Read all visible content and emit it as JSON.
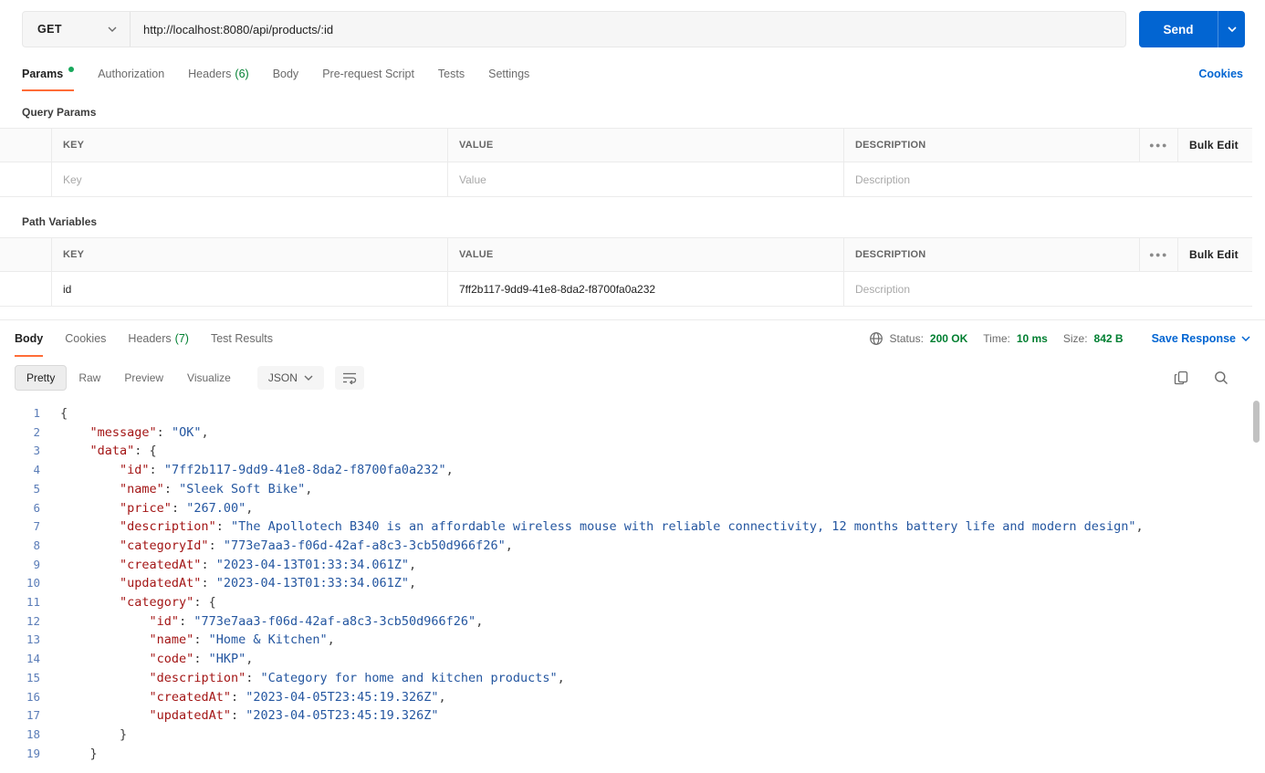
{
  "colors": {
    "accent_orange": "#ff6c37",
    "primary_blue": "#0265d2",
    "success_green": "#007f31",
    "json_key": "#a31515",
    "json_string": "#2456a0"
  },
  "request": {
    "method": "GET",
    "url": "http://localhost:8080/api/products/:id",
    "send_label": "Send",
    "cookies_link": "Cookies",
    "tabs": [
      {
        "label": "Params"
      },
      {
        "label": "Authorization"
      },
      {
        "label": "Headers",
        "count": "(6)"
      },
      {
        "label": "Body"
      },
      {
        "label": "Pre-request Script"
      },
      {
        "label": "Tests"
      },
      {
        "label": "Settings"
      }
    ]
  },
  "query_params": {
    "title": "Query Params",
    "col_key": "KEY",
    "col_value": "VALUE",
    "col_description": "DESCRIPTION",
    "more_icon": "●●●",
    "bulk_edit_label": "Bulk Edit",
    "row": {
      "key_placeholder": "Key",
      "value_placeholder": "Value",
      "description_placeholder": "Description"
    }
  },
  "path_variables": {
    "title": "Path Variables",
    "col_key": "KEY",
    "col_value": "VALUE",
    "col_description": "DESCRIPTION",
    "more_icon": "●●●",
    "bulk_edit_label": "Bulk Edit",
    "row": {
      "key": "id",
      "value": "7ff2b117-9dd9-41e8-8da2-f8700fa0a232",
      "description_placeholder": "Description"
    }
  },
  "response": {
    "tabs": [
      {
        "label": "Body"
      },
      {
        "label": "Cookies"
      },
      {
        "label": "Headers",
        "count": "(7)"
      },
      {
        "label": "Test Results"
      }
    ],
    "status_label": "Status:",
    "status_value": "200 OK",
    "time_label": "Time:",
    "time_value": "10 ms",
    "size_label": "Size:",
    "size_value": "842 B",
    "save_response_label": "Save Response",
    "view_tabs": {
      "pretty": "Pretty",
      "raw": "Raw",
      "preview": "Preview",
      "visualize": "Visualize"
    },
    "format_selected": "JSON",
    "code_lines": [
      "{",
      "    \"message\": \"OK\",",
      "    \"data\": {",
      "        \"id\": \"7ff2b117-9dd9-41e8-8da2-f8700fa0a232\",",
      "        \"name\": \"Sleek Soft Bike\",",
      "        \"price\": \"267.00\",",
      "        \"description\": \"The Apollotech B340 is an affordable wireless mouse with reliable connectivity, 12 months battery life and modern design\",",
      "        \"categoryId\": \"773e7aa3-f06d-42af-a8c3-3cb50d966f26\",",
      "        \"createdAt\": \"2023-04-13T01:33:34.061Z\",",
      "        \"updatedAt\": \"2023-04-13T01:33:34.061Z\",",
      "        \"category\": {",
      "            \"id\": \"773e7aa3-f06d-42af-a8c3-3cb50d966f26\",",
      "            \"name\": \"Home & Kitchen\",",
      "            \"code\": \"HKP\",",
      "            \"description\": \"Category for home and kitchen products\",",
      "            \"createdAt\": \"2023-04-05T23:45:19.326Z\",",
      "            \"updatedAt\": \"2023-04-05T23:45:19.326Z\"",
      "        }",
      "    }"
    ]
  }
}
